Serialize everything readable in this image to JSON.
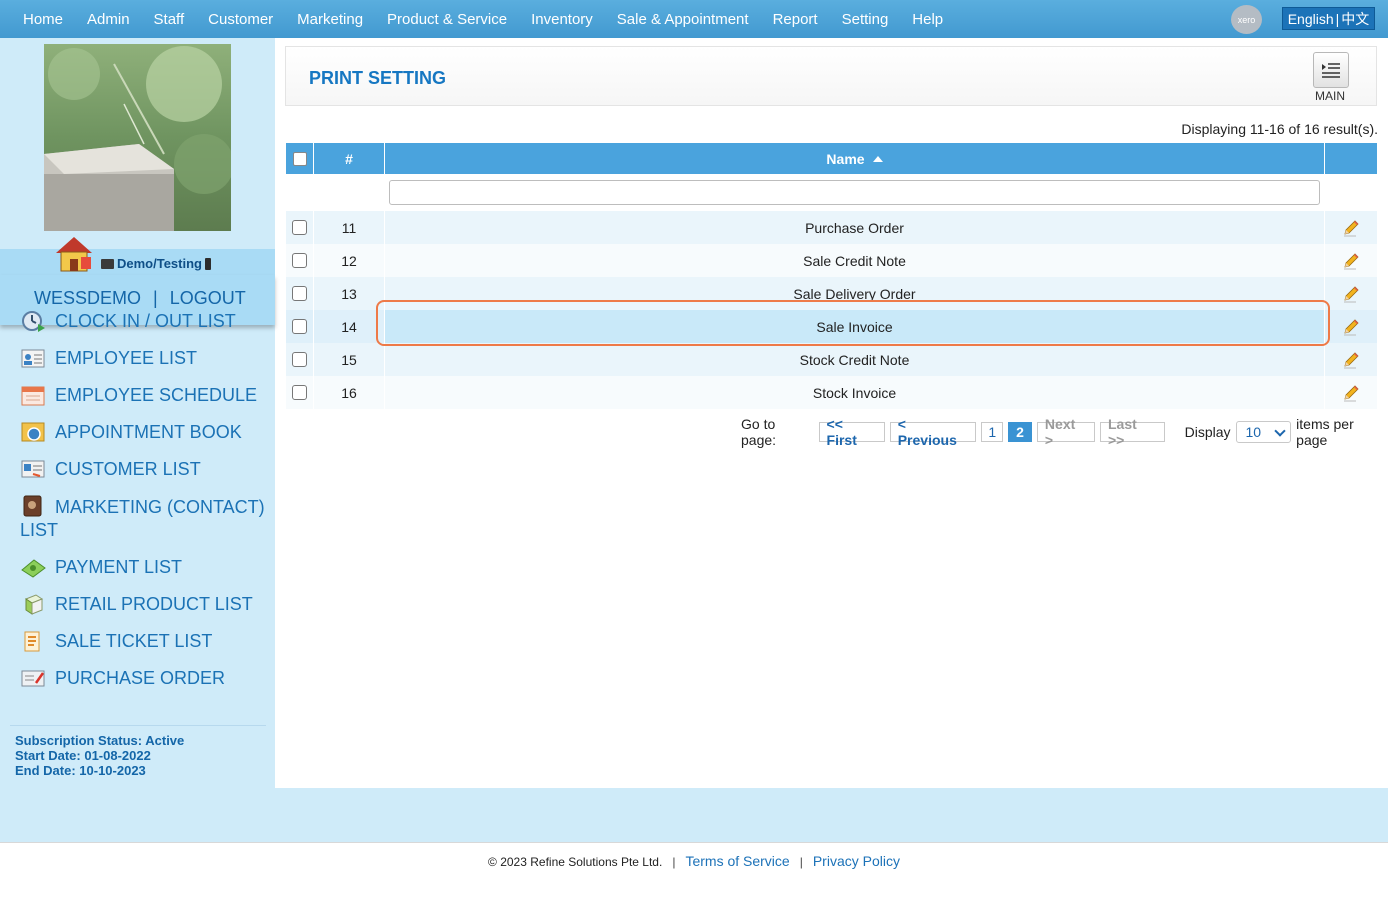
{
  "nav": {
    "items": [
      "Home",
      "Admin",
      "Staff",
      "Customer",
      "Marketing",
      "Product & Service",
      "Inventory",
      "Sale & Appointment",
      "Report",
      "Setting",
      "Help"
    ],
    "xero_label": "xero",
    "lang_english": "English",
    "lang_chinese": "中文"
  },
  "sidebar": {
    "account_label": "Demo/Testing",
    "username": "WESSDEMO",
    "logout": "LOGOUT",
    "menu": [
      {
        "label": "CLOCK IN / OUT LIST",
        "icon": "clock-icon"
      },
      {
        "label": "EMPLOYEE LIST",
        "icon": "employee-card-icon"
      },
      {
        "label": "EMPLOYEE SCHEDULE",
        "icon": "calendar-icon"
      },
      {
        "label": "APPOINTMENT BOOK",
        "icon": "appointment-book-icon"
      },
      {
        "label": "CUSTOMER LIST",
        "icon": "customer-card-icon"
      },
      {
        "label": "MARKETING (CONTACT) LIST",
        "icon": "contact-book-icon"
      },
      {
        "label": "PAYMENT LIST",
        "icon": "money-icon"
      },
      {
        "label": "RETAIL PRODUCT LIST",
        "icon": "product-box-icon"
      },
      {
        "label": "SALE TICKET LIST",
        "icon": "ticket-icon"
      },
      {
        "label": "PURCHASE ORDER",
        "icon": "purchase-order-icon"
      }
    ],
    "subscription": {
      "status": "Subscription Status: Active",
      "start": "Start Date: 01-08-2022",
      "end": "End Date: 10-10-2023"
    }
  },
  "page": {
    "title": "PRINT SETTING",
    "main_button_label": "MAIN",
    "result_summary": "Displaying 11-16 of 16 result(s).",
    "filter_placeholder": ""
  },
  "grid": {
    "columns": {
      "number": "#",
      "name": "Name"
    },
    "sort_direction": "ascending",
    "rows": [
      {
        "number": "11",
        "name": "Purchase Order"
      },
      {
        "number": "12",
        "name": "Sale Credit Note"
      },
      {
        "number": "13",
        "name": "Sale Delivery Order"
      },
      {
        "number": "14",
        "name": "Sale Invoice"
      },
      {
        "number": "15",
        "name": "Stock Credit Note"
      },
      {
        "number": "16",
        "name": "Stock Invoice"
      }
    ],
    "highlighted_row": "14"
  },
  "pager": {
    "goto_label": "Go to page:",
    "first": "<< First",
    "previous": "< Previous",
    "page_1": "1",
    "page_2": "2",
    "next": "Next >",
    "last": "Last >>",
    "display_label": "Display",
    "per_page_value": "10",
    "items_label": "items per page"
  },
  "footer": {
    "copyright": "© 2023 Refine Solutions Pte Ltd.",
    "terms": "Terms of Service",
    "privacy": "Privacy Policy"
  },
  "colors": {
    "nav_blue": "#4aa3dd",
    "sidebar_bg": "#cfebf9",
    "link_blue": "#1b72b5",
    "highlight": "#ee7a48"
  }
}
